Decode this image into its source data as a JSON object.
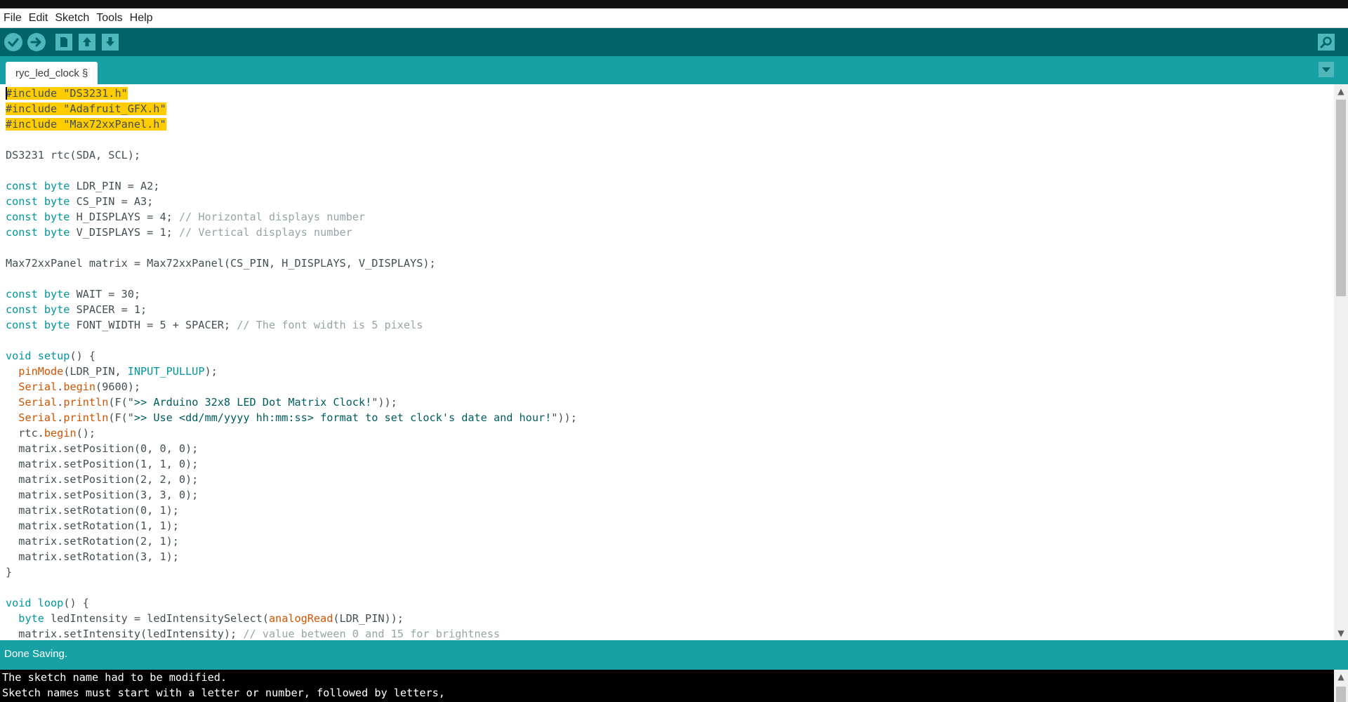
{
  "menu": [
    "File",
    "Edit",
    "Sketch",
    "Tools",
    "Help"
  ],
  "toolbar": {
    "buttons": [
      "verify-icon",
      "upload-icon",
      "new-icon",
      "open-icon",
      "save-icon"
    ],
    "right": "serial-monitor-icon"
  },
  "tab": {
    "label": "ryc_led_clock §"
  },
  "colors": {
    "toolbar": "#006468",
    "tabbar": "#17a1a5",
    "highlight": "#ffcc00",
    "keyword": "#00979c",
    "function": "#d35400",
    "comment": "#95a5a6"
  },
  "code": {
    "l1": "#include \"DS3231.h\"",
    "l2": "#include \"Adafruit_GFX.h\"",
    "l3": "#include \"Max72xxPanel.h\"",
    "l5": "DS3231 rtc(SDA, SCL);",
    "l7a": "const byte",
    "l7b": " LDR_PIN = A2;",
    "l8a": "const byte",
    "l8b": " CS_PIN = A3;",
    "l9a": "const byte",
    "l9b": " H_DISPLAYS = 4; ",
    "l9c": "// Horizontal displays number",
    "l10a": "const byte",
    "l10b": " V_DISPLAYS = 1; ",
    "l10c": "// Vertical displays number",
    "l12": "Max72xxPanel matrix = Max72xxPanel(CS_PIN, H_DISPLAYS, V_DISPLAYS);",
    "l14a": "const byte",
    "l14b": " WAIT = 30;",
    "l15a": "const byte",
    "l15b": " SPACER = 1;",
    "l16a": "const byte",
    "l16b": " FONT_WIDTH = 5 + SPACER; ",
    "l16c": "// The font width is 5 pixels",
    "l18a": "void",
    "l18b": " ",
    "l18c": "setup",
    "l18d": "() {",
    "l19a": "  ",
    "l19b": "pinMode",
    "l19c": "(LDR_PIN, ",
    "l19d": "INPUT_PULLUP",
    "l19e": ");",
    "l20a": "  ",
    "l20b": "Serial",
    "l20c": ".",
    "l20d": "begin",
    "l20e": "(9600);",
    "l21a": "  ",
    "l21b": "Serial",
    "l21c": ".",
    "l21d": "println",
    "l21e": "(F(\"",
    "l21f": ">> Arduino 32x8 LED Dot Matrix Clock!",
    "l21g": "\"));",
    "l22a": "  ",
    "l22b": "Serial",
    "l22c": ".",
    "l22d": "println",
    "l22e": "(F(\"",
    "l22f": ">> Use <dd/mm/yyyy hh:mm:ss> format to set clock's date and hour!",
    "l22g": "\"));",
    "l23a": "  rtc.",
    "l23b": "begin",
    "l23c": "();",
    "l24": "  matrix.setPosition(0, 0, 0);",
    "l25": "  matrix.setPosition(1, 1, 0);",
    "l26": "  matrix.setPosition(2, 2, 0);",
    "l27": "  matrix.setPosition(3, 3, 0);",
    "l28": "  matrix.setRotation(0, 1);",
    "l29": "  matrix.setRotation(1, 1);",
    "l30": "  matrix.setRotation(2, 1);",
    "l31": "  matrix.setRotation(3, 1);",
    "l32": "}",
    "l34a": "void",
    "l34b": " ",
    "l34c": "loop",
    "l34d": "() {",
    "l35a": "  ",
    "l35b": "byte",
    "l35c": " ledIntensity = ledIntensitySelect(",
    "l35d": "analogRead",
    "l35e": "(LDR_PIN));",
    "l36a": "  matrix.setIntensity(ledIntensity); ",
    "l36b": "// value between 0 and 15 for brightness"
  },
  "status": {
    "text": "Done Saving."
  },
  "console": {
    "line1": "The sketch name had to be modified.",
    "line2": "Sketch names must start with a letter or number, followed by letters,"
  }
}
